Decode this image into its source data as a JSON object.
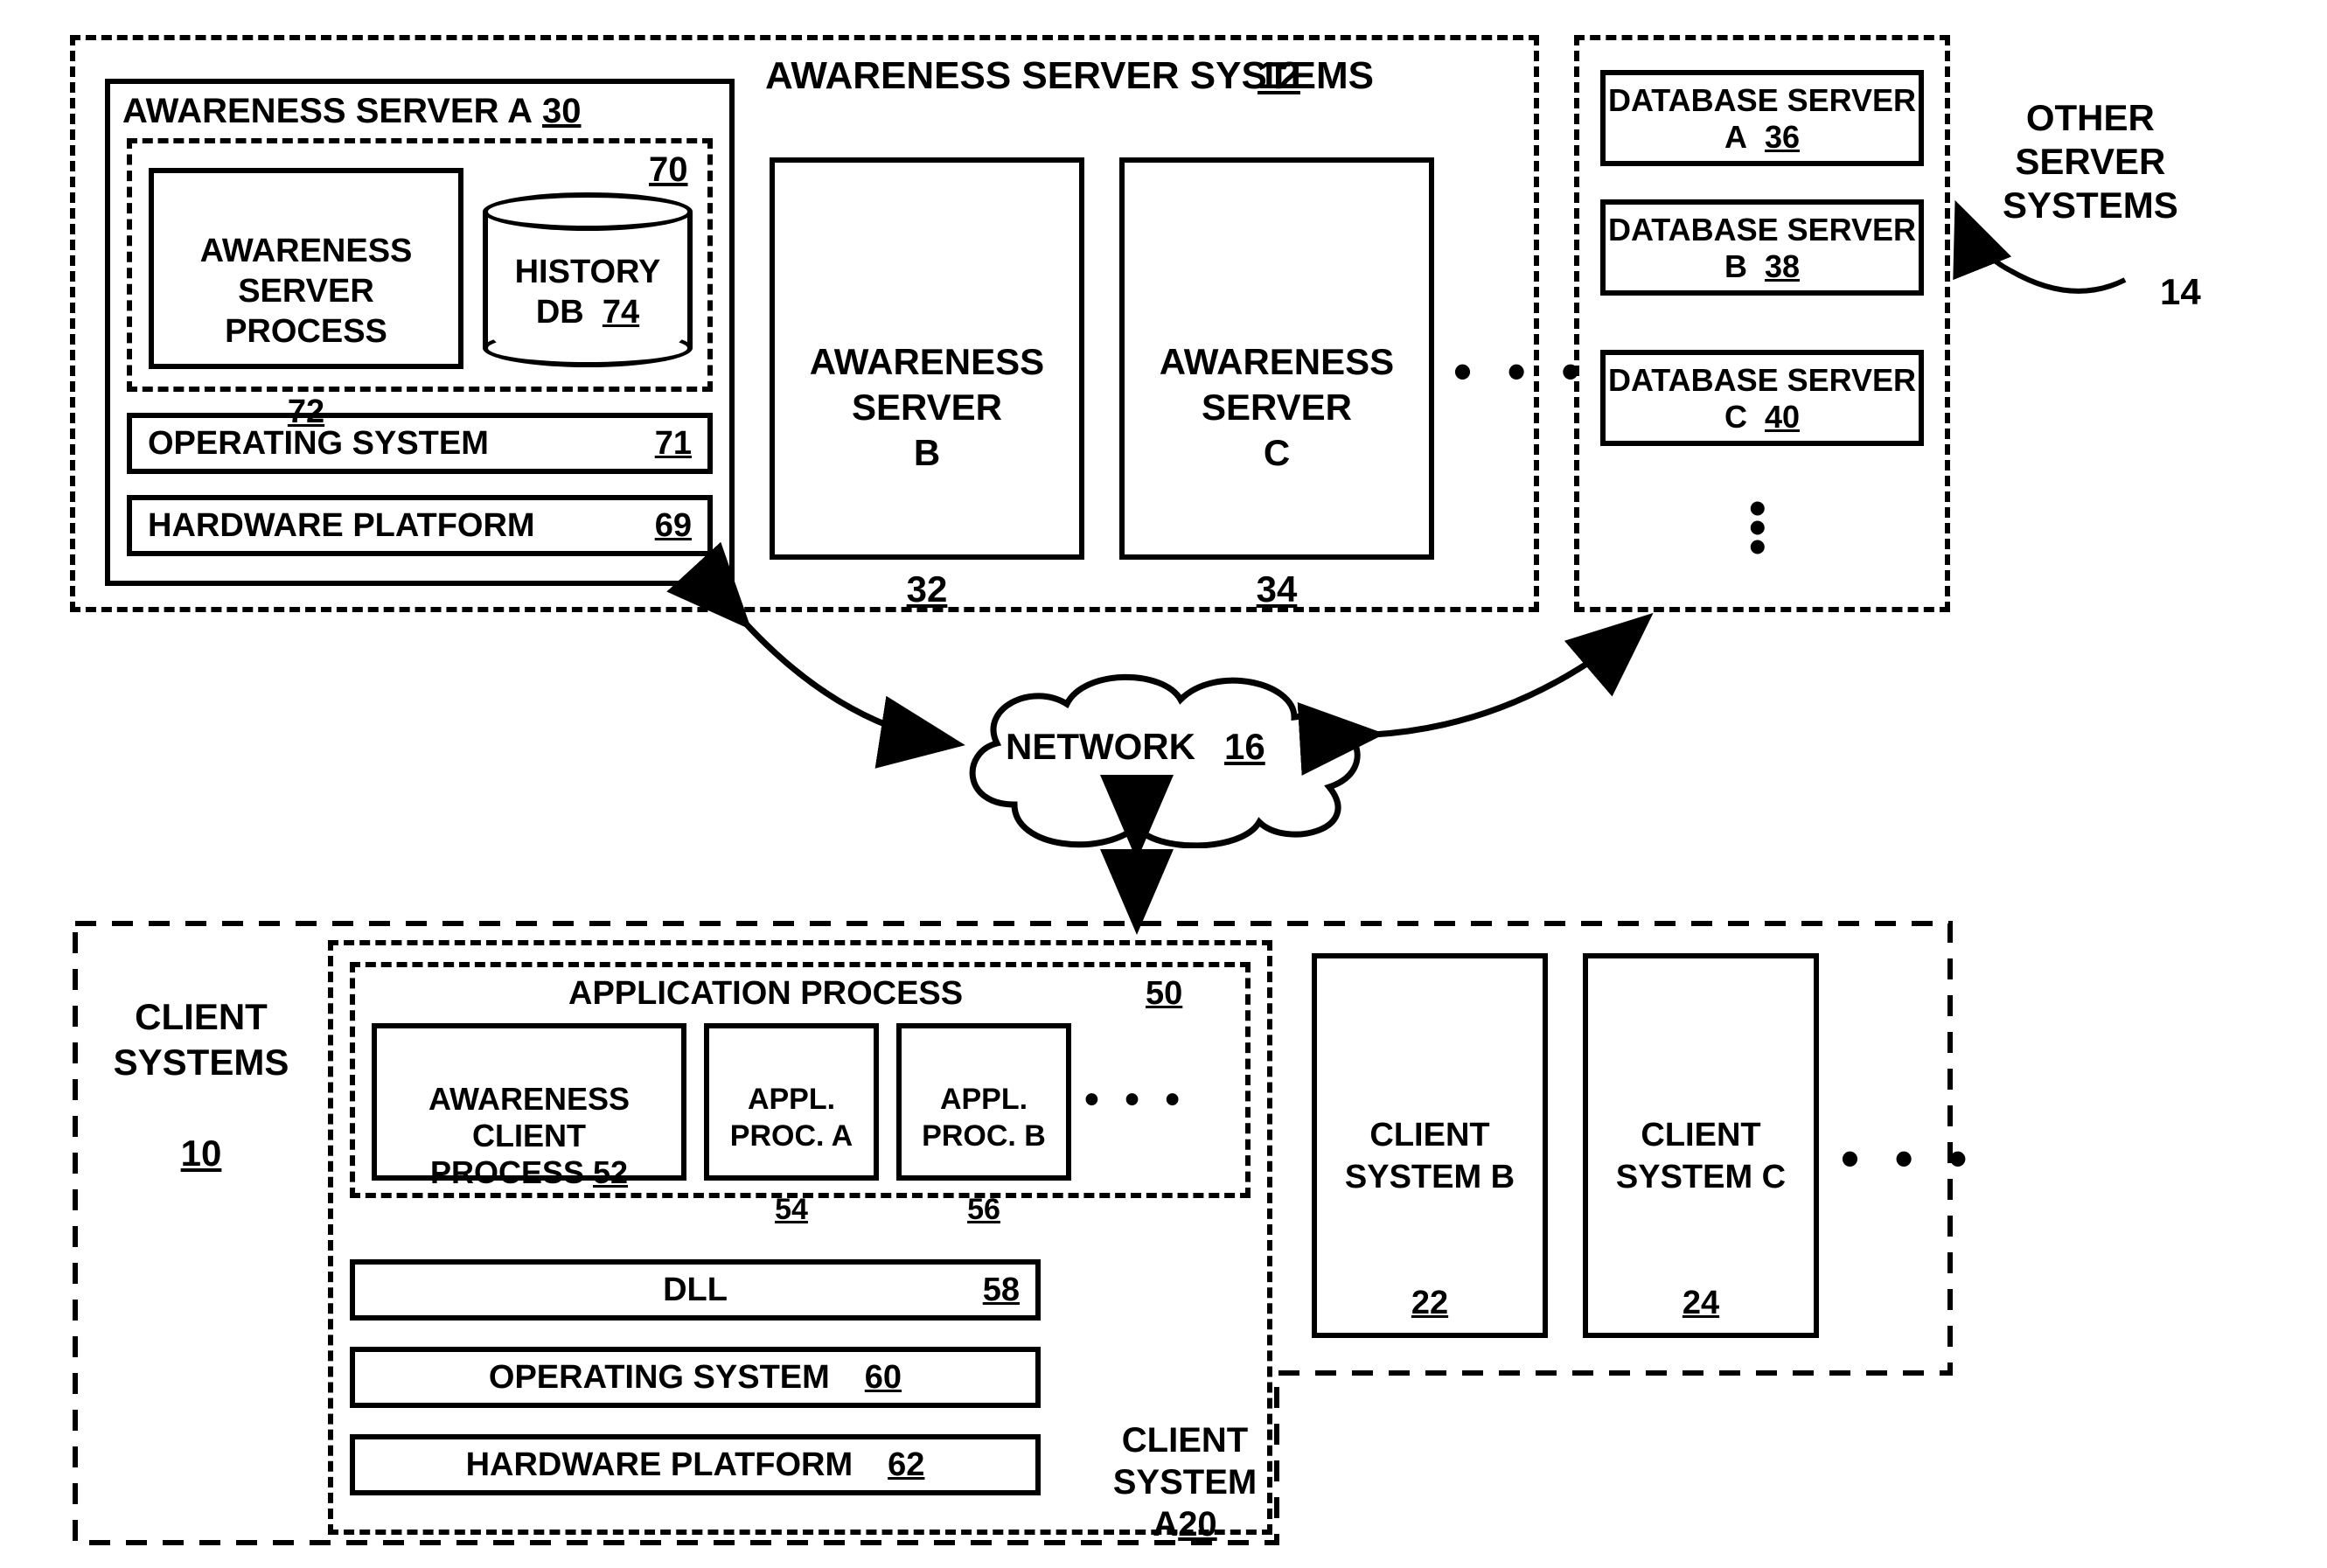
{
  "awareness_systems": {
    "title": "AWARENESS SERVER SYSTEMS",
    "ref": "12"
  },
  "server_a": {
    "title": "AWARENESS SERVER A",
    "ref": "30",
    "box70_ref": "70",
    "process": {
      "label": "AWARENESS\nSERVER\nPROCESS",
      "ref": "72"
    },
    "db": {
      "label": "HISTORY\nDB",
      "ref": "74"
    },
    "os": {
      "label": "OPERATING SYSTEM",
      "ref": "71"
    },
    "hw": {
      "label": "HARDWARE PLATFORM",
      "ref": "69"
    }
  },
  "server_b": {
    "label": "AWARENESS\nSERVER\nB",
    "ref": "32"
  },
  "server_c": {
    "label": "AWARENESS\nSERVER\nC",
    "ref": "34"
  },
  "other": {
    "label": "OTHER\nSERVER\nSYSTEMS",
    "ref": "14",
    "db_a": {
      "label": "DATABASE\nSERVER A",
      "ref": "36"
    },
    "db_b": {
      "label": "DATABASE\nSERVER B",
      "ref": "38"
    },
    "db_c": {
      "label": "DATABASE\nSERVER C",
      "ref": "40"
    }
  },
  "network": {
    "label": "NETWORK",
    "ref": "16"
  },
  "client_systems": {
    "label": "CLIENT\nSYSTEMS",
    "ref": "10"
  },
  "client_a": {
    "label": "CLIENT\nSYSTEM\nA",
    "ref": "20",
    "app_title": "APPLICATION PROCESS",
    "app_ref": "50",
    "acp": {
      "label": "AWARENESS\nCLIENT\nPROCESS",
      "ref": "52"
    },
    "proc_a": {
      "label": "APPL.\nPROC. A",
      "ref": "54"
    },
    "proc_b": {
      "label": "APPL.\nPROC. B",
      "ref": "56"
    },
    "dll": {
      "label": "DLL",
      "ref": "58"
    },
    "os": {
      "label": "OPERATING SYSTEM",
      "ref": "60"
    },
    "hw": {
      "label": "HARDWARE PLATFORM",
      "ref": "62"
    }
  },
  "client_b": {
    "label": "CLIENT\nSYSTEM B",
    "ref": "22"
  },
  "client_c": {
    "label": "CLIENT\nSYSTEM C",
    "ref": "24"
  },
  "ellipsis": "• • •"
}
